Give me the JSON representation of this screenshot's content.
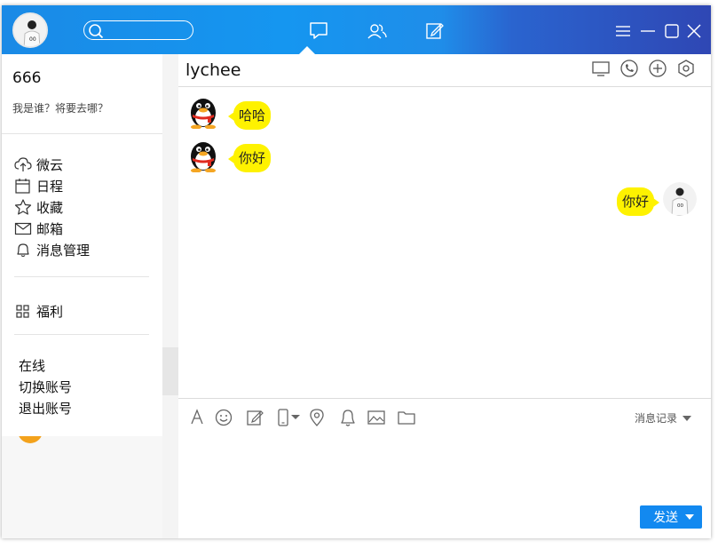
{
  "user": {
    "nickname": "666",
    "signature": "我是谁？将要去哪？"
  },
  "sidebar": {
    "apps": [
      {
        "label": "微云",
        "icon": "cloud-upload-icon"
      },
      {
        "label": "日程",
        "icon": "calendar-icon"
      },
      {
        "label": "收藏",
        "icon": "star-icon"
      },
      {
        "label": "邮箱",
        "icon": "mail-icon"
      },
      {
        "label": "消息管理",
        "icon": "bell-icon"
      }
    ],
    "extra": [
      {
        "label": "福利",
        "icon": "grid-icon"
      }
    ],
    "status_menu": [
      "在线",
      "切换账号",
      "退出账号"
    ]
  },
  "chat": {
    "title": "lychee",
    "messages": [
      {
        "side": "left",
        "text": "哈哈"
      },
      {
        "side": "left",
        "text": "你好"
      },
      {
        "side": "right",
        "text": "你好"
      }
    ],
    "history_label": "消息记录",
    "send_label": "发送"
  },
  "colors": {
    "topbar_blue": "#1596f0",
    "topbar_dark": "#2f47b4",
    "bubble": "#fef200",
    "send_button": "#1289f0"
  }
}
